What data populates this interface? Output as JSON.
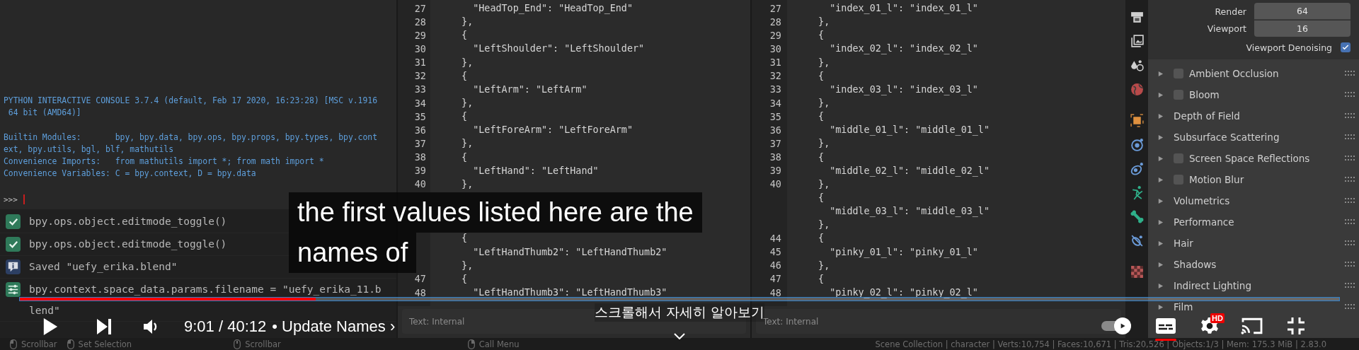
{
  "console": {
    "banner": [
      {
        "lines": [
          "PYTHON INTERACTIVE CONSOLE 3.7.4 (default, Feb 17 2020, 16:23:28) [MSC v.1916",
          " 64 bit (AMD64)]"
        ]
      },
      {
        "lines": [
          "Builtin Modules:       bpy, bpy.data, bpy.ops, bpy.props, bpy.types, bpy.cont",
          "ext, bpy.utils, bgl, blf, mathutils",
          "Convenience Imports:   from mathutils import *; from math import *",
          "Convenience Variables: C = bpy.context, D = bpy.data"
        ]
      }
    ],
    "prompt": ">>>"
  },
  "info_log": [
    {
      "kind": "success",
      "lines": [
        "bpy.ops.object.editmode_toggle()"
      ]
    },
    {
      "kind": "success",
      "lines": [
        "bpy.ops.object.editmode_toggle()"
      ]
    },
    {
      "kind": "info",
      "lines": [
        "Saved \"uefy_erika.blend\""
      ]
    },
    {
      "kind": "operator",
      "lines": [
        "bpy.context.space_data.params.filename = \"uefy_erika_11.b",
        "lend\""
      ]
    }
  ],
  "editors": [
    {
      "lines": [
        {
          "n": "27",
          "code": "    \"HeadTop_End\": \"HeadTop_End\""
        },
        {
          "n": "28",
          "code": "  },"
        },
        {
          "n": "29",
          "code": "  {"
        },
        {
          "n": "30",
          "code": "    \"LeftShoulder\": \"LeftShoulder\""
        },
        {
          "n": "31",
          "code": "  },"
        },
        {
          "n": "32",
          "code": "  {"
        },
        {
          "n": "33",
          "code": "    \"LeftArm\": \"LeftArm\""
        },
        {
          "n": "34",
          "code": "  },"
        },
        {
          "n": "35",
          "code": "  {"
        },
        {
          "n": "36",
          "code": "    \"LeftForeArm\": \"LeftForeArm\""
        },
        {
          "n": "37",
          "code": "  },"
        },
        {
          "n": "38",
          "code": "  {"
        },
        {
          "n": "39",
          "code": "    \"LeftHand\": \"LeftHand\""
        },
        {
          "n": "40",
          "code": "  },"
        },
        {
          "code": "  {",
          "gap_before": true
        },
        {
          "code": "    \"LeftHandThumb2\": \"LeftHandThumb2\""
        },
        {
          "code": "  },"
        },
        {
          "n": "47",
          "code": "  {"
        },
        {
          "n": "48",
          "code": "    \"LeftHandThumb3\": \"LeftHandThumb3\""
        }
      ],
      "footer": "Text: Internal"
    },
    {
      "lines": [
        {
          "n": "27",
          "code": "    \"index_01_l\": \"index_01_l\""
        },
        {
          "n": "28",
          "code": "  },"
        },
        {
          "n": "29",
          "code": "  {"
        },
        {
          "n": "30",
          "code": "    \"index_02_l\": \"index_02_l\""
        },
        {
          "n": "31",
          "code": "  },"
        },
        {
          "n": "32",
          "code": "  {"
        },
        {
          "n": "33",
          "code": "    \"index_03_l\": \"index_03_l\""
        },
        {
          "n": "34",
          "code": "  },"
        },
        {
          "n": "35",
          "code": "  {"
        },
        {
          "n": "36",
          "code": "    \"middle_01_l\": \"middle_01_l\""
        },
        {
          "n": "37",
          "code": "  },"
        },
        {
          "n": "38",
          "code": "  {"
        },
        {
          "n": "39",
          "code": "    \"middle_02_l\": \"middle_02_l\""
        },
        {
          "n": "40",
          "code": "  },"
        },
        {
          "code": "  {"
        },
        {
          "code": "    \"middle_03_l\": \"middle_03_l\""
        },
        {
          "code": "  },"
        },
        {
          "n": "44",
          "code": "  {"
        },
        {
          "n": "45",
          "code": "    \"pinky_01_l\": \"pinky_01_l\""
        },
        {
          "n": "46",
          "code": "  },"
        },
        {
          "n": "47",
          "code": "  {"
        },
        {
          "n": "48",
          "code": "    \"pinky_02_l\": \"pinky_02_l\""
        }
      ],
      "footer": "Text: Internal"
    }
  ],
  "properties": {
    "fields": [
      {
        "label": "Render",
        "value": "64"
      },
      {
        "label": "Viewport",
        "value": "16"
      }
    ],
    "denoising": {
      "label": "Viewport Denoising",
      "checked": true
    },
    "panels": [
      {
        "kind": "checkbox",
        "label": "Ambient Occlusion",
        "checked": false
      },
      {
        "kind": "checkbox",
        "label": "Bloom",
        "checked": false
      },
      {
        "kind": "plain",
        "label": "Depth of Field"
      },
      {
        "kind": "plain",
        "label": "Subsurface Scattering"
      },
      {
        "kind": "checkbox",
        "label": "Screen Space Reflections",
        "checked": false
      },
      {
        "kind": "checkbox",
        "label": "Motion Blur",
        "checked": false
      },
      {
        "kind": "plain",
        "label": "Volumetrics"
      },
      {
        "kind": "plain",
        "label": "Performance"
      },
      {
        "kind": "plain",
        "label": "Hair"
      },
      {
        "kind": "plain",
        "label": "Shadows"
      },
      {
        "kind": "plain",
        "label": "Indirect Lighting"
      },
      {
        "kind": "plain",
        "label": "Film"
      }
    ]
  },
  "status_bar": {
    "hints": [
      {
        "kind": "left",
        "label": "Scrollbar"
      },
      {
        "kind": "drag",
        "label": "Set Selection"
      },
      {
        "kind": "middle",
        "label": "Scrollbar"
      },
      {
        "kind": "right",
        "label": "Call Menu"
      }
    ],
    "stats": "Scene Collection | character | Verts:10,754 | Faces:10,671 | Tris:20,526 | Objects:1/3 | Mem: 175.3 MiB | 2.83.0"
  },
  "player": {
    "captions": [
      "the first values listed here are the",
      "names of"
    ],
    "progress": {
      "level": 0.224
    },
    "time": "9:01 / 40:12",
    "chapter": "• Update Names ›",
    "hint": "스크롤해서 자세히 알아보기",
    "autoplay": {
      "on": true
    },
    "captions_on": true,
    "quality_badge": "HD"
  }
}
